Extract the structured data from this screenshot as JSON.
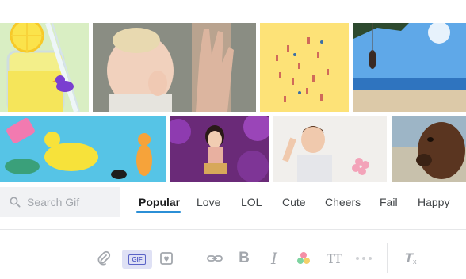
{
  "gifs": [
    {
      "name": "lemonade-jar-duck"
    },
    {
      "name": "baby-high-five"
    },
    {
      "name": "yellow-dancers"
    },
    {
      "name": "beach-swing-jump"
    },
    {
      "name": "pool-floaties"
    },
    {
      "name": "hula-figurine"
    },
    {
      "name": "boy-waving"
    },
    {
      "name": "dog-closeup"
    }
  ],
  "search": {
    "placeholder": "Search Gif",
    "value": ""
  },
  "categories": [
    "Popular",
    "Love",
    "LOL",
    "Cute",
    "Cheers",
    "Fail",
    "Happy"
  ],
  "active_category": "Popular",
  "toolbar": {
    "gif_label": "GIF",
    "bold_label": "B",
    "italic_label": "I",
    "text_size_label": "TT",
    "clear_format_label": "T",
    "clear_format_sub": "x"
  },
  "colors": {
    "accent": "#2b8fd6",
    "icon": "#a3a7ad",
    "gif_active": "#5a63c7"
  }
}
